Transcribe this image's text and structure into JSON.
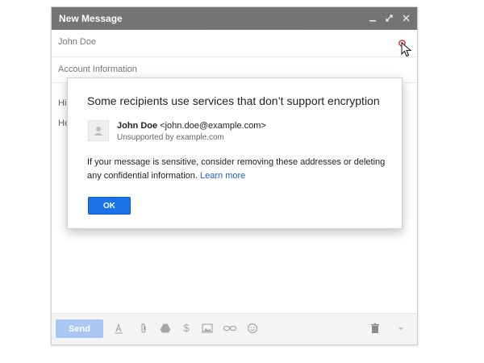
{
  "compose": {
    "title": "New Message",
    "recipients_value": "John Doe",
    "subject_value": "Account Information",
    "body_line1": "Hi",
    "body_line2": "He"
  },
  "toolbar": {
    "send_label": "Send",
    "dollar_glyph": "$"
  },
  "dialog": {
    "title": "Some recipients use services that don’t support encryption",
    "contact_name": "John Doe",
    "contact_email": "<john.doe@example.com>",
    "contact_status": "Unsupported by example.com",
    "message": "If your message is sensitive, consider removing these addresses or deleting any confidential information.",
    "learn_more": "Learn more",
    "ok_label": "OK"
  },
  "colors": {
    "accent": "#1a73e8",
    "link": "#1a5fd1",
    "send_disabled": "#a9c6f5",
    "encryption_warning": "#d93025"
  },
  "icons": [
    "minimize-icon",
    "expand-icon",
    "close-icon",
    "encryption-warning-icon",
    "format-text-icon",
    "attach-icon",
    "drive-icon",
    "money-icon",
    "photo-icon",
    "link-icon",
    "emoji-icon",
    "trash-icon",
    "more-options-icon"
  ]
}
